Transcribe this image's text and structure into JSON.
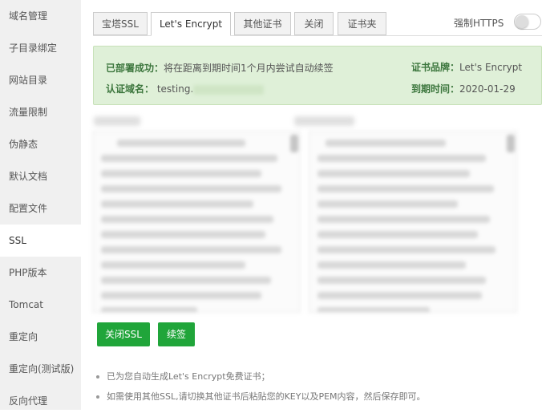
{
  "sidebar": {
    "items": [
      "域名管理",
      "子目录绑定",
      "网站目录",
      "流量限制",
      "伪静态",
      "默认文档",
      "配置文件",
      "SSL",
      "PHP版本",
      "Tomcat",
      "重定向",
      "重定向(测试版)",
      "反向代理"
    ],
    "active_index": 7
  },
  "tabs": [
    "宝塔SSL",
    "Let's Encrypt",
    "其他证书",
    "关闭",
    "证书夹"
  ],
  "active_tab": 1,
  "force_https": {
    "label": "强制HTTPS",
    "enabled": false
  },
  "status": {
    "deployed_label": "已部署成功：",
    "deployed_text": "将在距离到期时间1个月内尝试自动续签",
    "domain_label": "认证域名：",
    "domain_value": "testing.",
    "brand_label": "证书品牌：",
    "brand_value": "Let's Encrypt",
    "expire_label": "到期时间：",
    "expire_value": "2020-01-29"
  },
  "buttons": {
    "close_ssl": "关闭SSL",
    "renew": "续签"
  },
  "notes": [
    "已为您自动生成Let's Encrypt免费证书；",
    "如需使用其他SSL,请切换其他证书后粘贴您的KEY以及PEM内容，然后保存即可。"
  ],
  "colors": {
    "accent": "#20a53a",
    "status_bg": "#dff0d8",
    "status_text": "#3c763d"
  }
}
